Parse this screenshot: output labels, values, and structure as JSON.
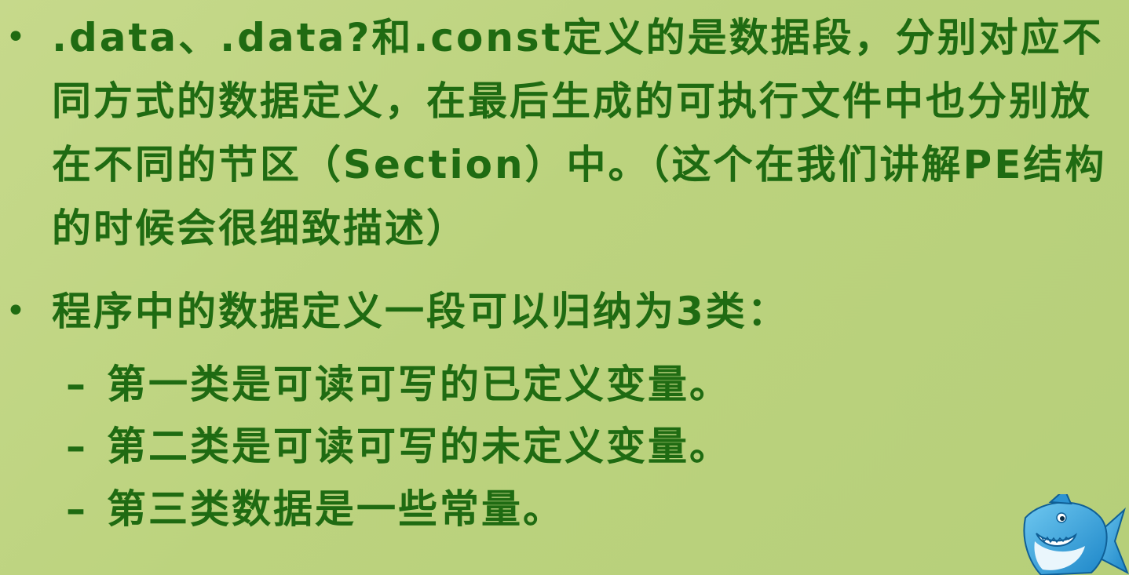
{
  "slide": {
    "bullets": [
      {
        "text": ".data、.data?和.const定义的是数据段，分别对应不同方式的数据定义，在最后生成的可执行文件中也分别放在不同的节区（Section）中。（这个在我们讲解PE结构的时候会很细致描述）"
      },
      {
        "text": "程序中的数据定义一段可以归纳为3类："
      }
    ],
    "subitems": [
      {
        "dash": "–",
        "text": "第一类是可读可写的已定义变量。"
      },
      {
        "dash": "–",
        "text": "第二类是可读可写的未定义变量。"
      },
      {
        "dash": "–",
        "text": "第三类数据是一些常量。"
      }
    ],
    "bullet_symbol": "•"
  },
  "logo": {
    "icon": "shark-mascot-icon"
  },
  "colors": {
    "text": "#1f6b12",
    "background": "#c2d685"
  }
}
